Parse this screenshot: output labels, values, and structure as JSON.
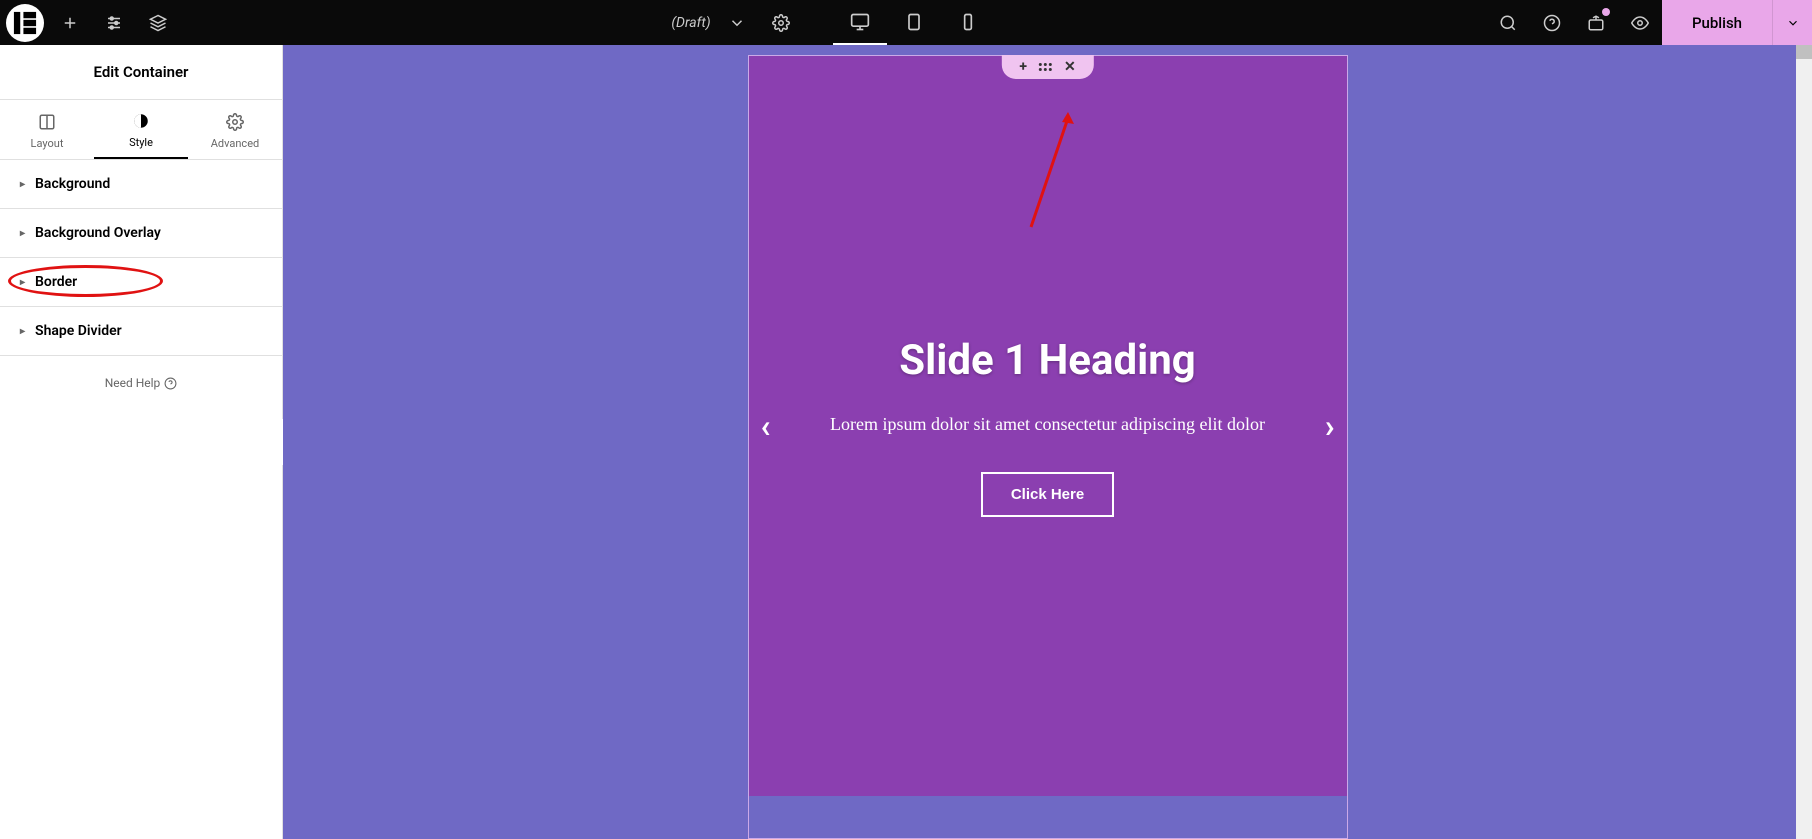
{
  "topbar": {
    "draft_label": "(Draft)",
    "publish_label": "Publish"
  },
  "panel": {
    "title": "Edit Container",
    "tabs": {
      "layout": "Layout",
      "style": "Style",
      "advanced": "Advanced"
    },
    "accordion": {
      "background": "Background",
      "background_overlay": "Background Overlay",
      "border": "Border",
      "shape_divider": "Shape Divider"
    },
    "need_help": "Need Help"
  },
  "slide": {
    "heading": "Slide 1 Heading",
    "text": "Lorem ipsum dolor sit amet consectetur adipiscing elit dolor",
    "button": "Click Here"
  }
}
